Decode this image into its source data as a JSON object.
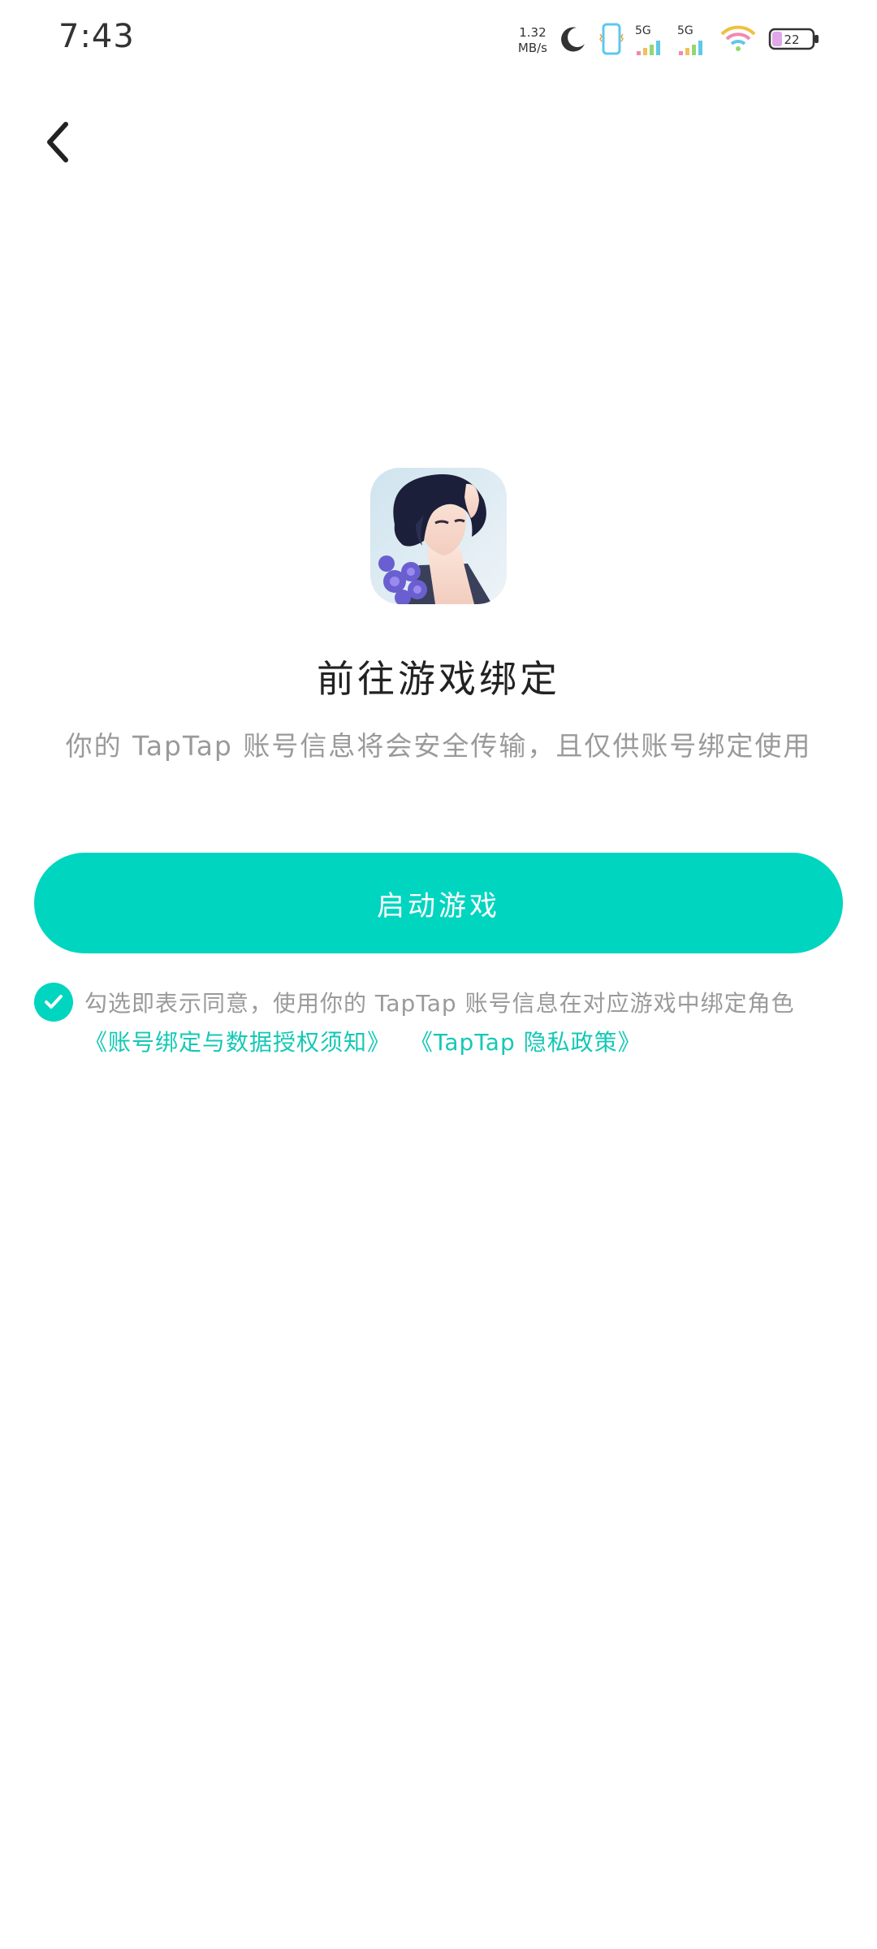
{
  "status_bar": {
    "time": "7:43",
    "net_speed_value": "1.32",
    "net_speed_unit": "MB/s",
    "sim1_label": "5G",
    "sim2_label": "5G",
    "battery": "22"
  },
  "app": {
    "icon_name": "game-app-icon"
  },
  "main": {
    "title": "前往游戏绑定",
    "subtitle": "你的 TapTap 账号信息将会安全传输，且仅供账号绑定使用",
    "launch_button": "启动游戏"
  },
  "consent": {
    "checked": true,
    "text": "勾选即表示同意，使用你的 TapTap 账号信息在对应游戏中绑定角色",
    "link_binding": "《账号绑定与数据授权须知》",
    "link_privacy": "《TapTap 隐私政策》"
  },
  "colors": {
    "accent": "#00d5c0",
    "link": "#14c8b5",
    "muted_text": "#9a9a9a"
  }
}
